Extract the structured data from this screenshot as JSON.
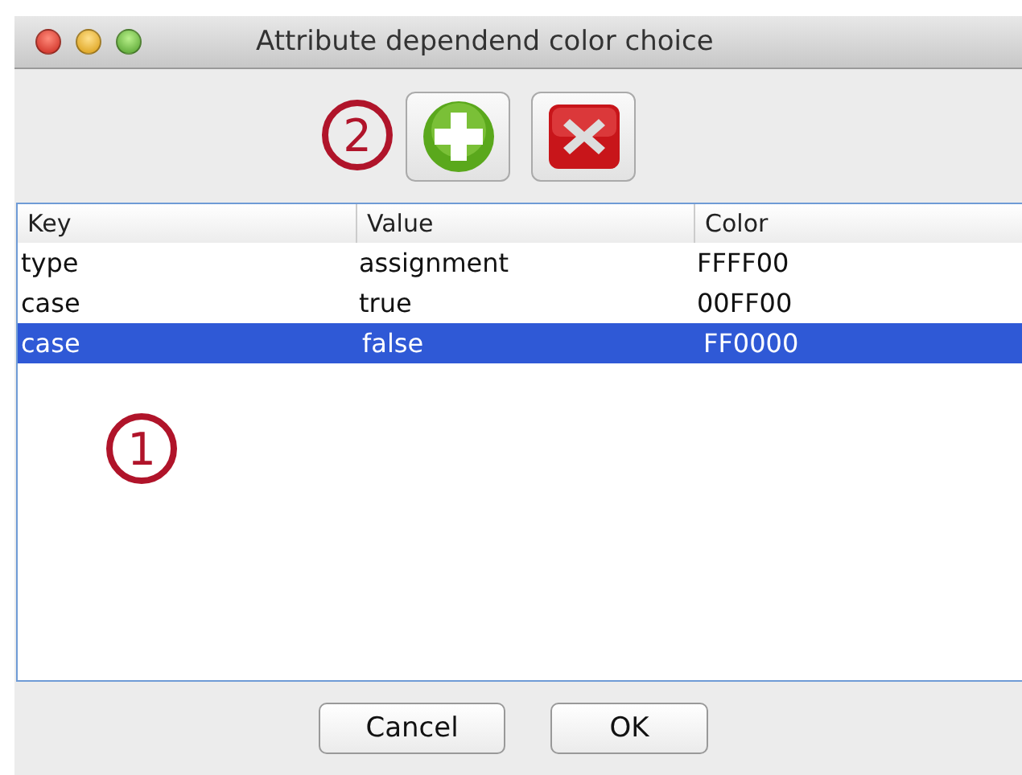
{
  "window": {
    "title": "Attribute dependend color choice"
  },
  "toolbar": {
    "marker": "2",
    "buttons": [
      {
        "kind": "add"
      },
      {
        "kind": "remove"
      }
    ]
  },
  "table": {
    "marker": "1",
    "columns": [
      "Key",
      "Value",
      "Color"
    ],
    "rows": [
      {
        "cells": [
          "type",
          "assignment",
          "FFFF00"
        ],
        "selected": false
      },
      {
        "cells": [
          "case",
          "true",
          "00FF00"
        ],
        "selected": false
      },
      {
        "cells": [
          "case",
          "false",
          "FF0000"
        ],
        "selected": true
      }
    ]
  },
  "buttons": [
    "Cancel",
    "OK"
  ]
}
